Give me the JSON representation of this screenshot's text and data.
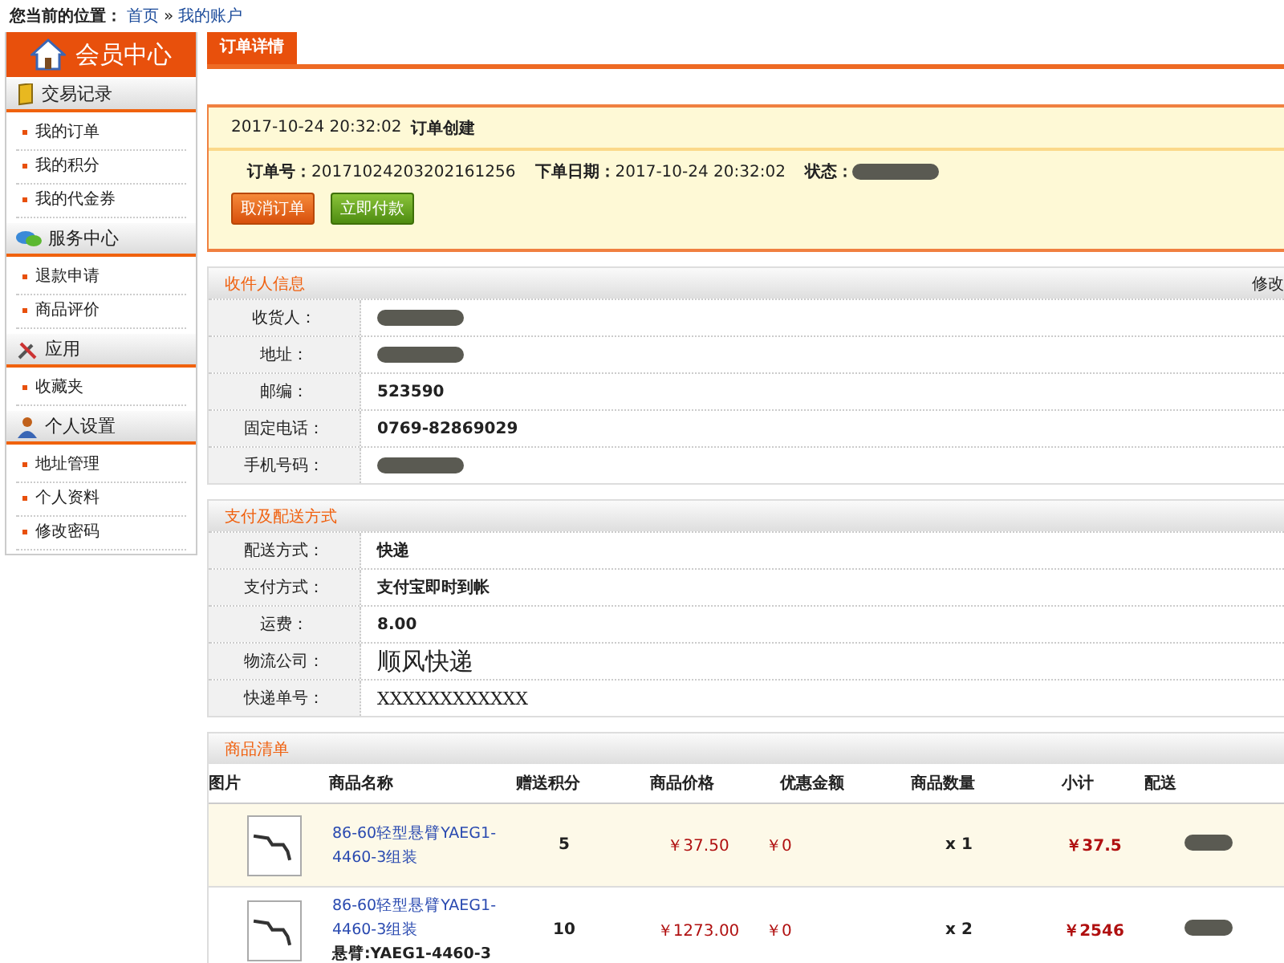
{
  "breadcrumb": {
    "label": "您当前的位置：",
    "links": [
      "首页",
      "我的账户"
    ],
    "separator": "»"
  },
  "sidebar": {
    "title": "会员中心",
    "groups": [
      {
        "title": "交易记录",
        "items": [
          "我的订单",
          "我的积分",
          "我的代金券"
        ]
      },
      {
        "title": "服务中心",
        "items": [
          "退款申请",
          "商品评价"
        ]
      },
      {
        "title": "应用",
        "items": [
          "收藏夹"
        ]
      },
      {
        "title": "个人设置",
        "items": [
          "地址管理",
          "个人资料",
          "修改密码"
        ]
      }
    ]
  },
  "tab": {
    "label": "订单详情",
    "selected": true
  },
  "order": {
    "created_time": "2017-10-24 20:32:02",
    "created_label": "订单创建",
    "number_label": "订单号：",
    "number": "20171024203202161256",
    "date_label": "下单日期：",
    "date": "2017-10-24 20:32:02",
    "status_label": "状态：",
    "status_redacted": true,
    "buttons": [
      {
        "label": "取消订单",
        "kind": "cancel"
      },
      {
        "label": "立即付款",
        "kind": "pay"
      }
    ]
  },
  "receiver": {
    "title": "收件人信息",
    "action": "修改",
    "rows": [
      {
        "label": "收货人：",
        "redacted": true
      },
      {
        "label": "地址：",
        "redacted": true
      },
      {
        "label": "邮编：",
        "value": "523590",
        "redacted": false
      },
      {
        "label": "固定电话：",
        "value": "0769-82869029",
        "redacted": false
      },
      {
        "label": "手机号码：",
        "redacted": true
      }
    ]
  },
  "shipping": {
    "title": "支付及配送方式",
    "rows": [
      {
        "label": "配送方式：",
        "value": "快递",
        "kind": "small"
      },
      {
        "label": "支付方式：",
        "value": "支付宝即时到帐",
        "kind": "small"
      },
      {
        "label": "运费：",
        "value": "8.00",
        "kind": "small"
      },
      {
        "label": "物流公司：",
        "value": "顺风快递",
        "kind": "large"
      },
      {
        "label": "快递单号：",
        "value": "XXXXXXXXXXXX",
        "kind": "serif"
      }
    ]
  },
  "products": {
    "title": "商品清单",
    "columns": [
      "图片",
      "商品名称",
      "赠送积分",
      "商品价格",
      "优惠金额",
      "商品数量",
      "小计",
      "配送"
    ],
    "rows": [
      {
        "highlighted": true,
        "name": "86-60轻型悬臂YAEG1-4460-3组装",
        "points": "5",
        "price": "￥37.50",
        "discount": "￥0",
        "quantity": "x 1",
        "subtotal": "￥37.5",
        "delivery_redacted": true
      },
      {
        "highlighted": false,
        "name": "86-60轻型悬臂YAEG1-4460-3组装",
        "spec": "悬臂:YAEG1-4460-3",
        "points": "10",
        "price": "￥1273.00",
        "discount": "￥0",
        "quantity": "x 2",
        "subtotal": "￥2546",
        "delivery_redacted": true
      }
    ]
  }
}
